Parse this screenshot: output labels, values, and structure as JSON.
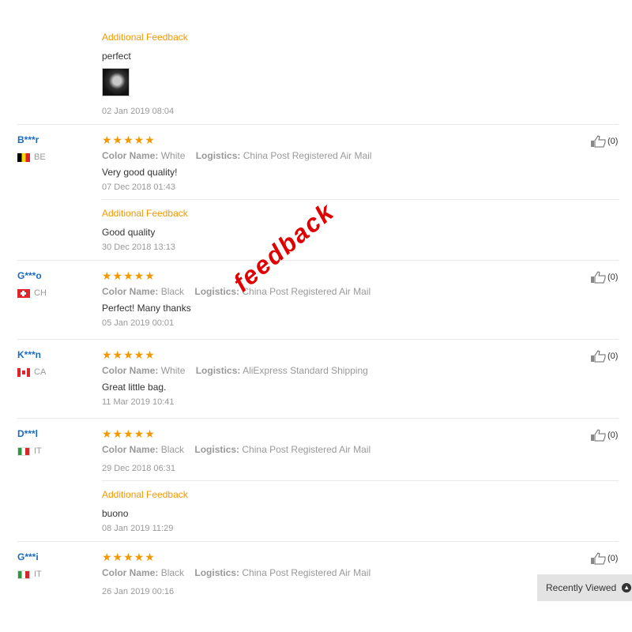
{
  "top_block": {
    "additional_label": "Additional Feedback",
    "text": "perfect",
    "date": "02 Jan 2019 08:04"
  },
  "reviews": [
    {
      "user": "B***r",
      "country": "BE",
      "stars": "★★★★★",
      "color_label": "Color Name:",
      "color": "White",
      "logistics_label": "Logistics:",
      "logistics": "China Post Registered Air Mail",
      "text": "Very good quality!",
      "date": "07 Dec 2018 01:43",
      "additional_label": "Additional Feedback",
      "additional_text": "Good quality",
      "additional_date": "30 Dec 2018 13:13",
      "likes": "(0)"
    },
    {
      "user": "G***o",
      "country": "CH",
      "stars": "★★★★★",
      "color_label": "Color Name:",
      "color": "Black",
      "logistics_label": "Logistics:",
      "logistics": "China Post Registered Air Mail",
      "text": "Perfect! Many thanks",
      "date": "05 Jan 2019 00:01",
      "likes": "(0)"
    },
    {
      "user": "K***n",
      "country": "CA",
      "stars": "★★★★★",
      "color_label": "Color Name:",
      "color": "White",
      "logistics_label": "Logistics:",
      "logistics": "AliExpress Standard Shipping",
      "text": "Great little bag.",
      "date": "11 Mar 2019 10:41",
      "likes": "(0)"
    },
    {
      "user": "D***l",
      "country": "IT",
      "stars": "★★★★★",
      "color_label": "Color Name:",
      "color": "Black",
      "logistics_label": "Logistics:",
      "logistics": "China Post Registered Air Mail",
      "date": "29 Dec 2018 06:31",
      "additional_label": "Additional Feedback",
      "additional_text": "buono",
      "additional_date": "08 Jan 2019 11:29",
      "likes": "(0)"
    },
    {
      "user": "G***i",
      "country": "IT",
      "stars": "★★★★★",
      "color_label": "Color Name:",
      "color": "Black",
      "logistics_label": "Logistics:",
      "logistics": "China Post Registered Air Mail",
      "date": "26 Jan 2019 00:16",
      "likes": "(0)"
    }
  ],
  "watermark": "feedback",
  "recently_viewed": "Recently Viewed",
  "colors": {
    "accent": "#f39800",
    "user_link": "#1a6bc0",
    "watermark": "#e00000"
  }
}
